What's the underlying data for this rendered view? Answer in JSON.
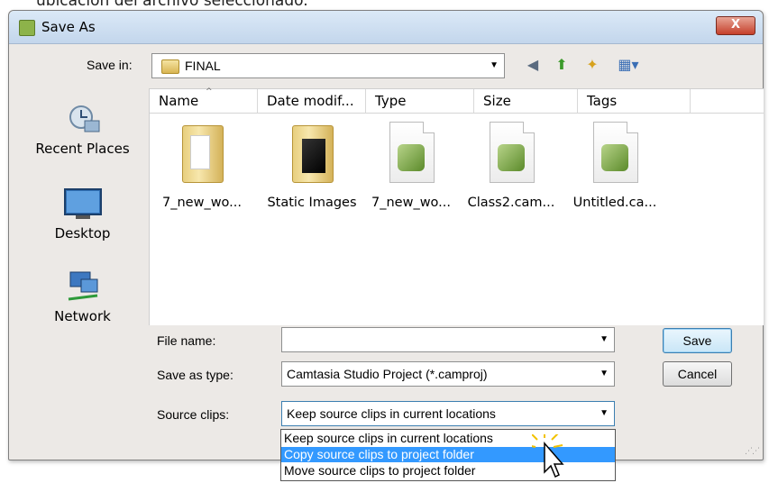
{
  "caption": "ubicación del archivo seleccionado.",
  "window": {
    "title": "Save As",
    "close_label": "X"
  },
  "save_in": {
    "label": "Save in:",
    "value": "FINAL"
  },
  "toolbar": {
    "back_icon": "back-icon",
    "up_icon": "up-folder-icon",
    "new_folder_icon": "new-folder-icon",
    "views_icon": "views-icon"
  },
  "places": [
    {
      "label": "Recent Places",
      "icon": "recent-places-icon"
    },
    {
      "label": "Desktop",
      "icon": "desktop-icon"
    },
    {
      "label": "Network",
      "icon": "network-icon"
    }
  ],
  "columns": [
    "Name",
    "Date modif...",
    "Type",
    "Size",
    "Tags"
  ],
  "files": [
    {
      "name": "7_new_wo...",
      "kind": "folder"
    },
    {
      "name": "Static Images",
      "kind": "folder-dark"
    },
    {
      "name": "7_new_wo...",
      "kind": "doc"
    },
    {
      "name": "Class2.cam...",
      "kind": "doc"
    },
    {
      "name": "Untitled.ca...",
      "kind": "doc"
    }
  ],
  "form": {
    "file_name_label": "File name:",
    "file_name_value": "",
    "save_type_label": "Save as type:",
    "save_type_value": "Camtasia Studio Project (*.camproj)",
    "source_clips_label": "Source clips:",
    "source_clips_value": "Keep source clips in current locations"
  },
  "buttons": {
    "save": "Save",
    "cancel": "Cancel"
  },
  "source_options": [
    "Keep source clips in current locations",
    "Copy source clips to project folder",
    "Move source clips to project folder"
  ],
  "colors": {
    "selection": "#3399ff",
    "titlebar": "#c3d6ec"
  }
}
